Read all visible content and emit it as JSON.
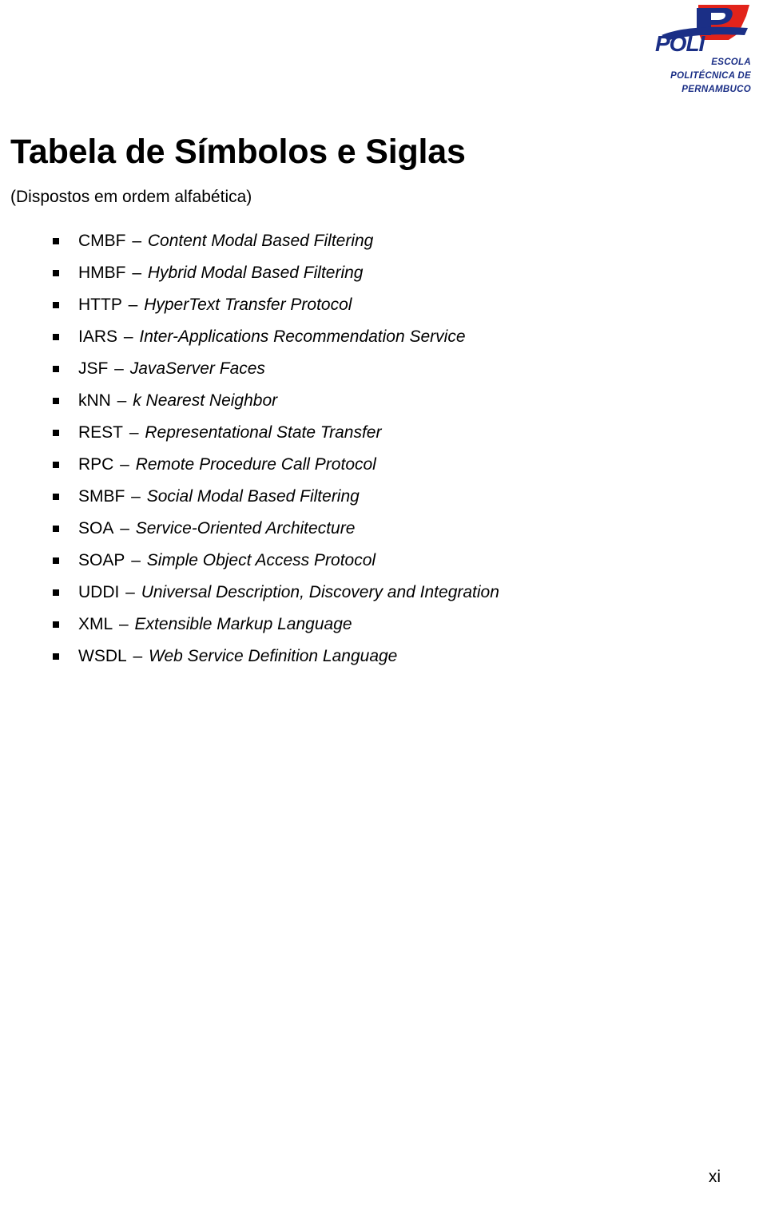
{
  "logo": {
    "wordmark": "POLI",
    "mark_icon": "poli-logo-icon",
    "colors": {
      "red": "#e2231a",
      "blue": "#1b2f86"
    },
    "lines": [
      "ESCOLA",
      "POLITÉCNICA DE",
      "PERNAMBUCO"
    ]
  },
  "title": "Tabela de Símbolos e Siglas",
  "subtitle": "(Dispostos em ordem alfabética)",
  "list": {
    "bullet_icon": "square-bullet-icon",
    "separator": "–",
    "items": [
      {
        "term": "CMBF",
        "definition": "Content Modal Based Filtering"
      },
      {
        "term": "HMBF",
        "definition": "Hybrid Modal Based Filtering"
      },
      {
        "term": "HTTP",
        "definition": "HyperText Transfer Protocol"
      },
      {
        "term": "IARS",
        "definition": "Inter-Applications Recommendation Service"
      },
      {
        "term": "JSF",
        "definition": "JavaServer Faces"
      },
      {
        "term": "kNN",
        "definition": "k Nearest Neighbor"
      },
      {
        "term": "REST",
        "definition": "Representational State Transfer"
      },
      {
        "term": "RPC",
        "definition": "Remote Procedure Call Protocol"
      },
      {
        "term": "SMBF",
        "definition": "Social Modal Based Filtering"
      },
      {
        "term": "SOA",
        "definition": "Service-Oriented Architecture"
      },
      {
        "term": "SOAP",
        "definition": "Simple Object Access Protocol"
      },
      {
        "term": "UDDI",
        "definition": "Universal Description, Discovery and Integration"
      },
      {
        "term": "XML",
        "definition": "Extensible Markup Language"
      },
      {
        "term": "WSDL",
        "definition": "Web Service Definition Language"
      }
    ]
  },
  "page_number": "xi"
}
